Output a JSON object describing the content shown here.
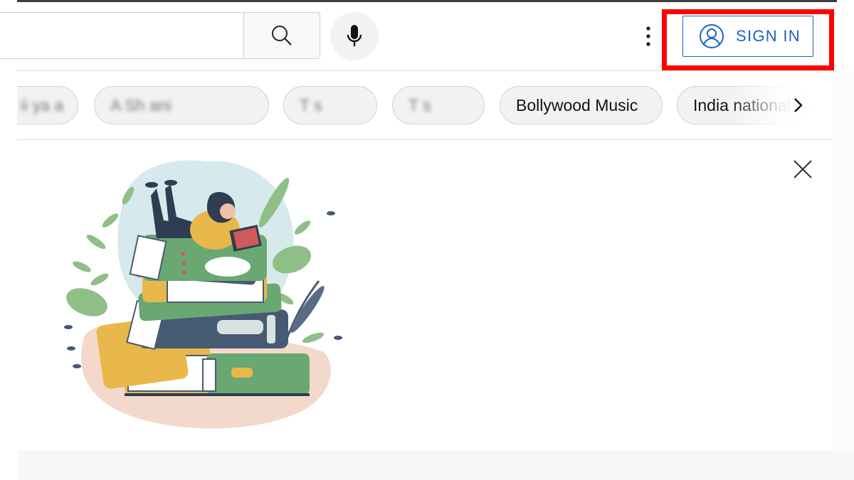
{
  "header": {
    "search_placeholder": "",
    "search_icon": "search-icon",
    "mic_icon": "microphone-icon",
    "more_icon": "vertical-dots-icon",
    "sign_in_label": "SIGN IN",
    "sign_in_icon": "account-circle-icon"
  },
  "chips": [
    {
      "label": "ii  ya  a",
      "blurred": true
    },
    {
      "label": "A   Sh    ani",
      "blurred": true
    },
    {
      "label": "T    s",
      "blurred": true
    },
    {
      "label": "T    s",
      "blurred": true
    },
    {
      "label": "Bollywood Music",
      "blurred": false
    },
    {
      "label": "India national cric",
      "blurred": false
    }
  ],
  "chip_next_icon": "chevron-right-icon",
  "content": {
    "close_icon": "close-icon",
    "illustration": "woman-reading-on-book-stack-illustration"
  },
  "colors": {
    "accent_blue": "#1a63c4",
    "highlight_red": "#ff0000",
    "book_green": "#6aa873",
    "book_yellow": "#e9b84a",
    "book_navy": "#465a73"
  }
}
